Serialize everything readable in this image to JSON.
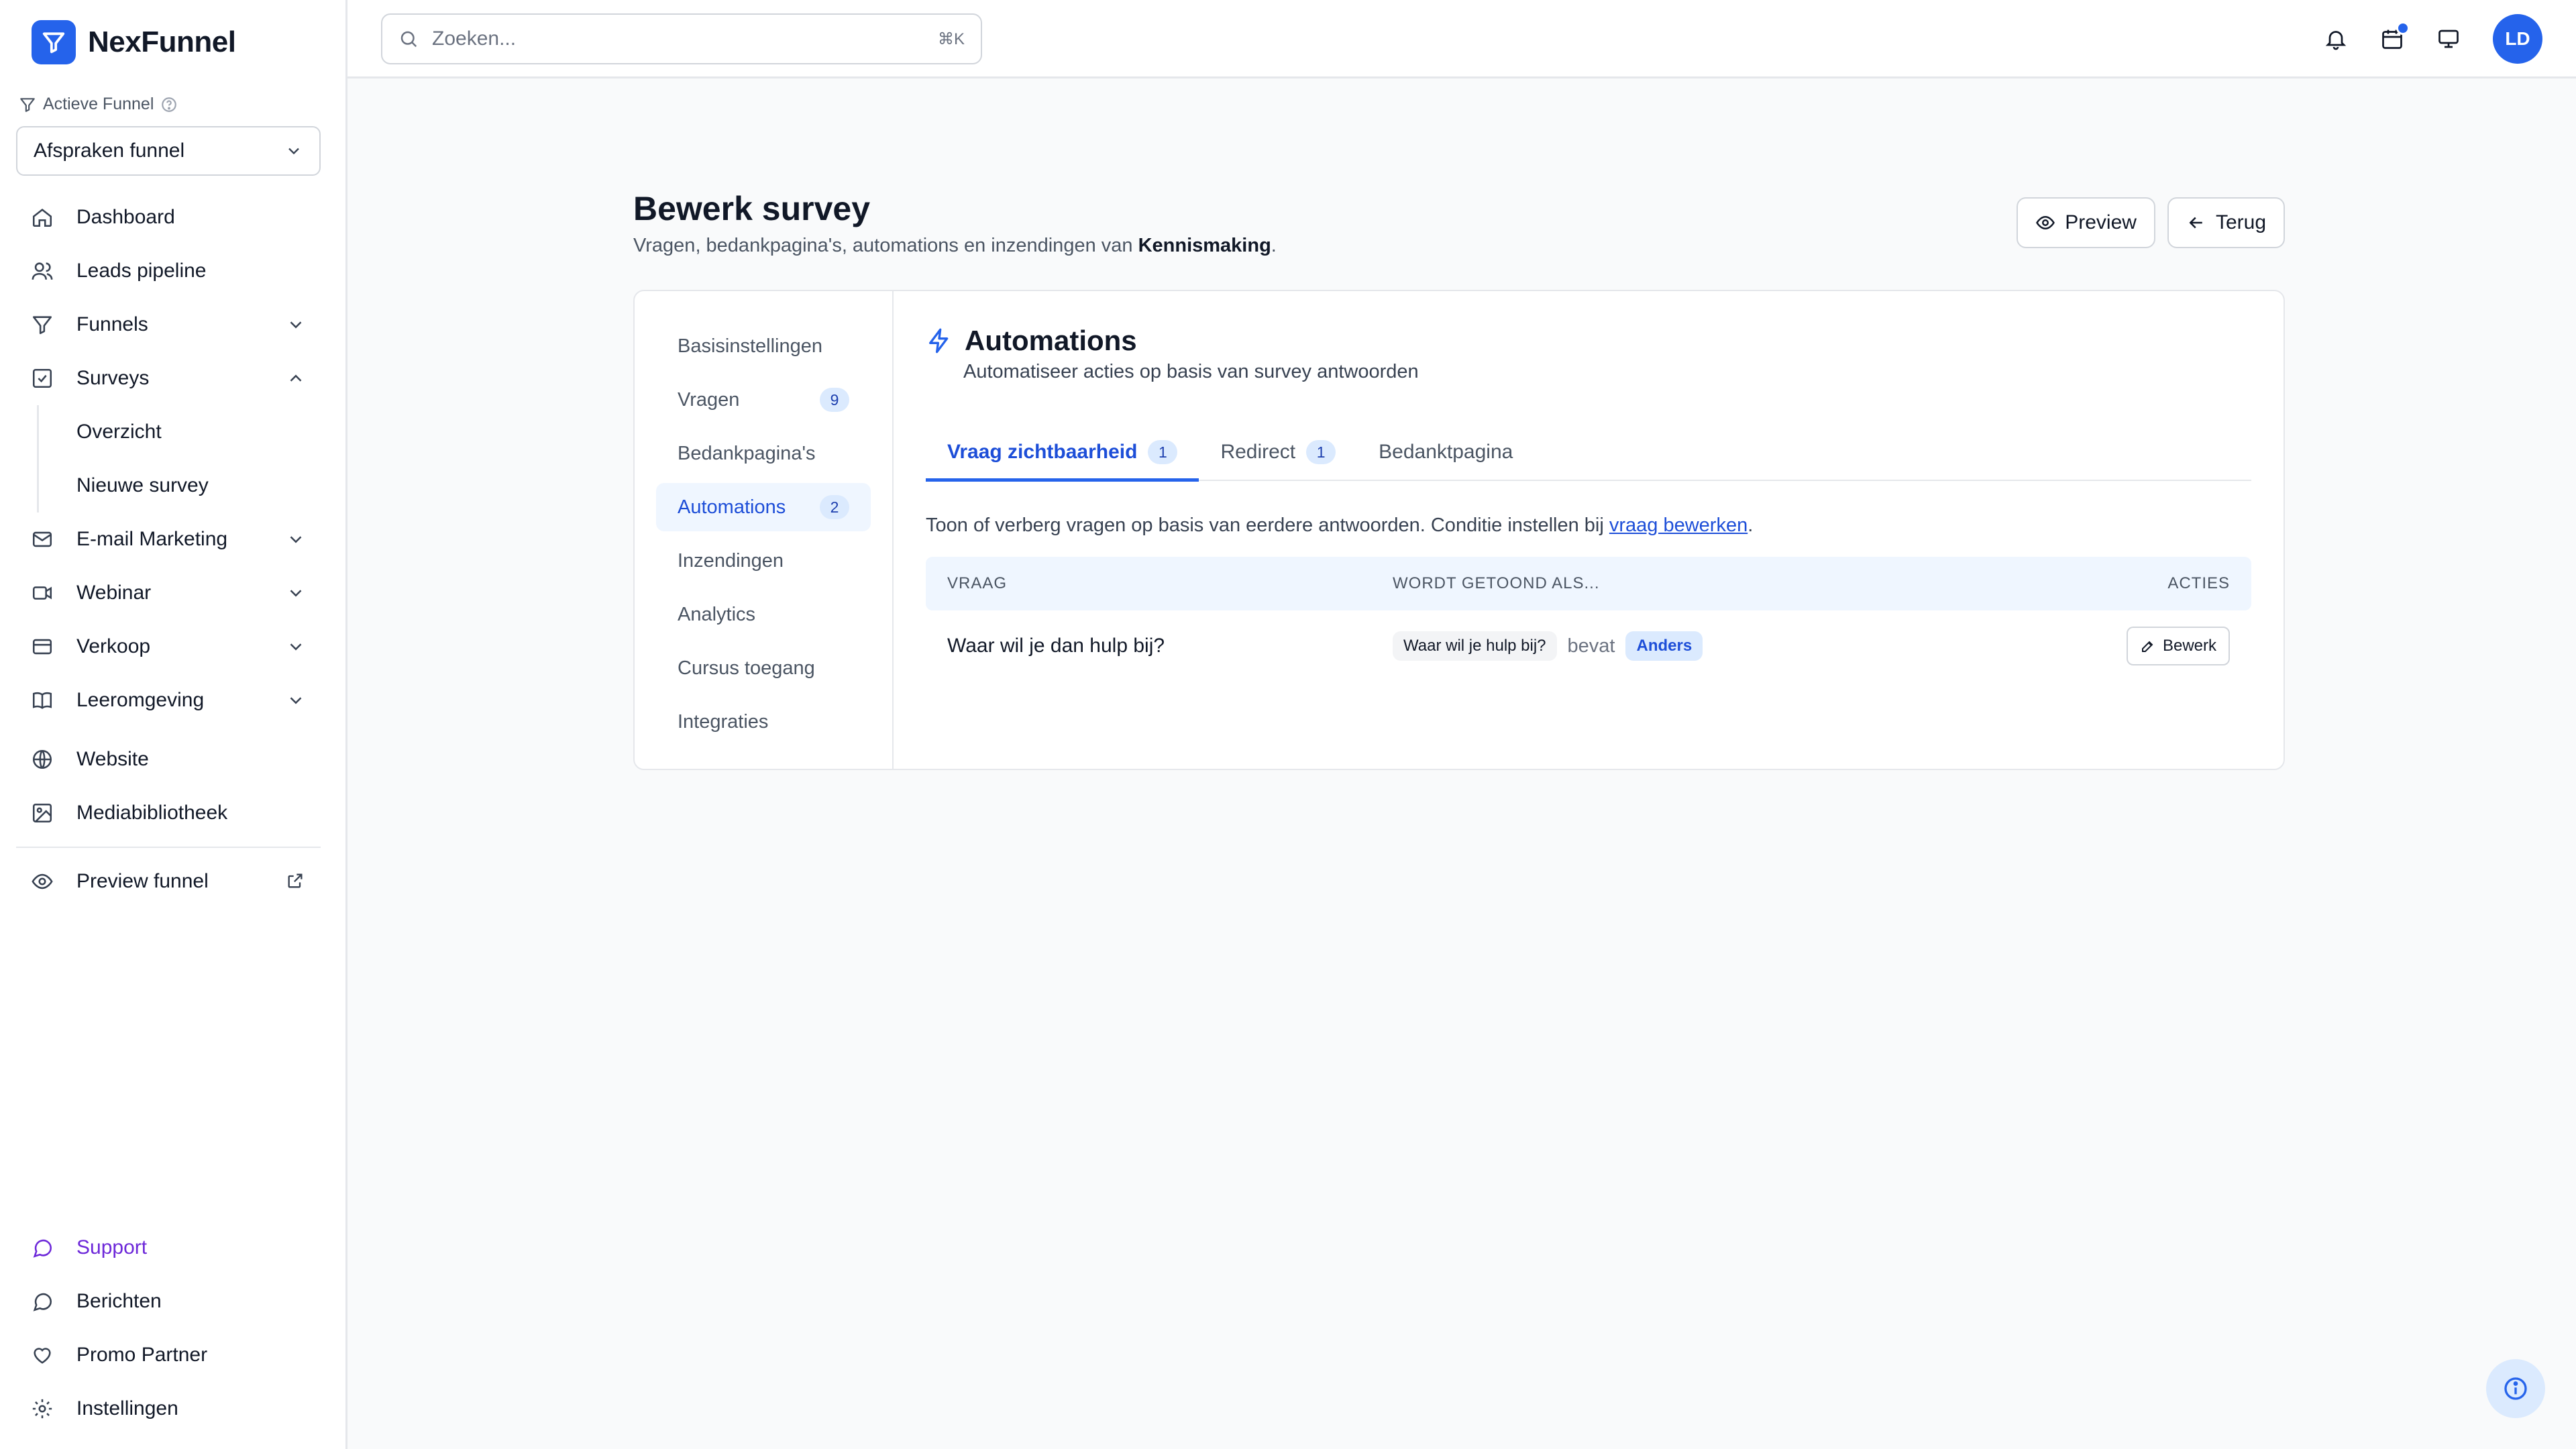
{
  "app": {
    "name": "NexFunnel"
  },
  "sidebar": {
    "funnel_label": "Actieve Funnel",
    "funnel_selected": "Afspraken funnel",
    "items": [
      {
        "label": "Dashboard",
        "icon": "home-icon"
      },
      {
        "label": "Leads pipeline",
        "icon": "users-icon"
      },
      {
        "label": "Funnels",
        "icon": "filter-icon"
      },
      {
        "label": "Surveys",
        "icon": "checkbox-icon"
      },
      {
        "label": "Overzicht"
      },
      {
        "label": "Nieuwe survey"
      },
      {
        "label": "E-mail Marketing",
        "icon": "mail-icon"
      },
      {
        "label": "Webinar",
        "icon": "video-icon"
      },
      {
        "label": "Verkoop",
        "icon": "card-icon"
      },
      {
        "label": "Leeromgeving",
        "icon": "book-icon"
      },
      {
        "label": "Website",
        "icon": "globe-icon"
      },
      {
        "label": "Mediabibliotheek",
        "icon": "image-icon"
      },
      {
        "label": "Preview funnel",
        "icon": "eye-icon"
      }
    ],
    "bottom": [
      {
        "label": "Support",
        "icon": "chat-icon"
      },
      {
        "label": "Berichten",
        "icon": "message-icon"
      },
      {
        "label": "Promo Partner",
        "icon": "heart-icon"
      },
      {
        "label": "Instellingen",
        "icon": "gear-icon"
      }
    ]
  },
  "topbar": {
    "search_placeholder": "Zoeken...",
    "shortcut": "⌘K",
    "avatar_initials": "LD"
  },
  "page": {
    "title": "Bewerk survey",
    "subtitle_prefix": "Vragen, bedankpagina's, automations en inzendingen van ",
    "subtitle_name": "Kennismaking",
    "subtitle_suffix": ".",
    "preview_label": "Preview",
    "back_label": "Terug"
  },
  "subnav": [
    {
      "label": "Basisinstellingen",
      "count": ""
    },
    {
      "label": "Vragen",
      "count": "9"
    },
    {
      "label": "Bedankpagina's",
      "count": ""
    },
    {
      "label": "Automations",
      "count": "2"
    },
    {
      "label": "Inzendingen",
      "count": ""
    },
    {
      "label": "Analytics",
      "count": ""
    },
    {
      "label": "Cursus toegang",
      "count": ""
    },
    {
      "label": "Integraties",
      "count": ""
    }
  ],
  "automations": {
    "title": "Automations",
    "description": "Automatiseer acties op basis van survey antwoorden",
    "tabs": [
      {
        "label": "Vraag zichtbaarheid",
        "count": "1"
      },
      {
        "label": "Redirect",
        "count": "1"
      },
      {
        "label": "Bedanktpagina",
        "count": ""
      }
    ],
    "info_prefix": "Toon of verberg vragen op basis van eerdere antwoorden. Conditie instellen bij ",
    "info_link": "vraag bewerken",
    "info_suffix": ".",
    "table": {
      "headers": {
        "question": "VRAAG",
        "condition": "WORDT GETOOND ALS...",
        "actions": "ACTIES"
      },
      "rows": [
        {
          "question": "Waar wil je dan hulp bij?",
          "cond_question": "Waar wil je hulp bij?",
          "operator": "bevat",
          "value": "Anders",
          "action": "Bewerk"
        }
      ]
    }
  },
  "colors": {
    "accent": "#2563eb",
    "support": "#6d28d9"
  }
}
